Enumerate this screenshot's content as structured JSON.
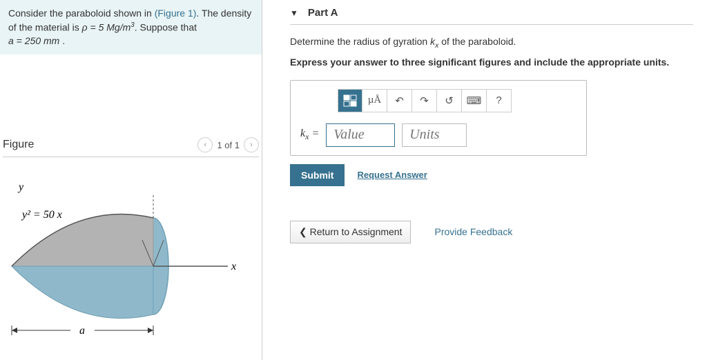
{
  "problem": {
    "line1_pre": "Consider the paraboloid shown in ",
    "figure_ref": "(Figure 1)",
    "line1_post": ". The density of the material is ",
    "rho_expr": "ρ = 5 Mg/m",
    "rho_exp": "3",
    "line1_end": ". Suppose that",
    "a_expr": "a = 250 mm",
    "period": " ."
  },
  "figure": {
    "header": "Figure",
    "nav": "1 of 1",
    "eqn": "y² = 50 x",
    "ylabel": "y",
    "xlabel": "x",
    "alabel": "a"
  },
  "part": {
    "title": "Part A",
    "question_pre": "Determine the radius of gyration ",
    "k_sym_html": "k",
    "k_sub": "x",
    "question_post": " of the paraboloid.",
    "instruction": "Express your answer to three significant figures and include the appropriate units.",
    "toolbar": {
      "templates": "▯▯",
      "units": "µÅ",
      "undo": "↶",
      "redo": "↷",
      "reset": "↺",
      "keyboard": "⌨",
      "help": "?"
    },
    "answer": {
      "label_k": "k",
      "label_sub": "x",
      "eq": " =",
      "value_placeholder": "Value",
      "units_placeholder": "Units"
    },
    "submit": "Submit",
    "request": "Request Answer"
  },
  "footer": {
    "return": "Return to Assignment",
    "feedback": "Provide Feedback"
  }
}
